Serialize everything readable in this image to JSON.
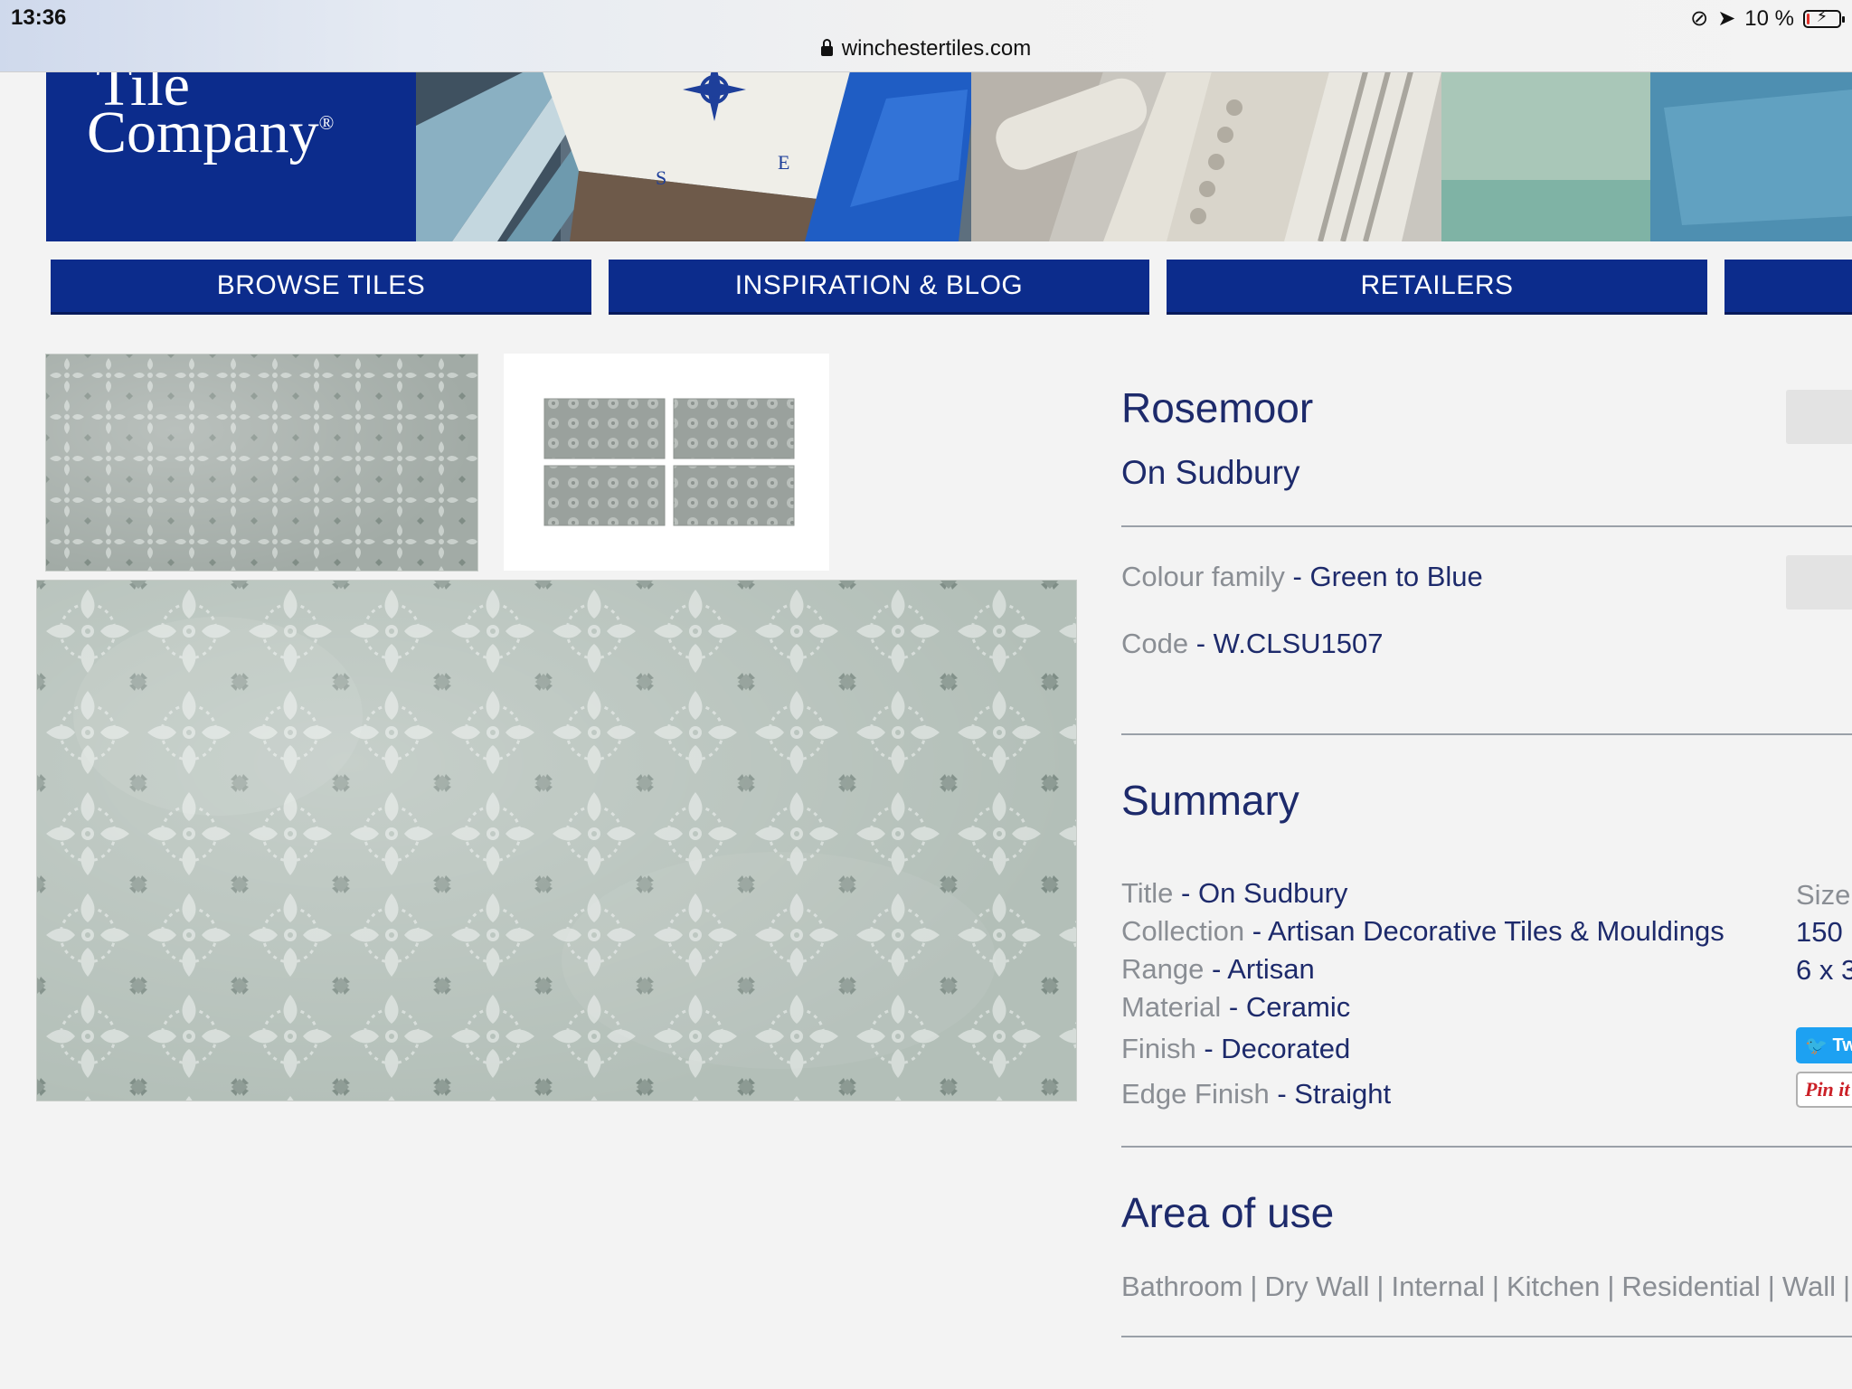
{
  "status": {
    "time": "13:36",
    "battery": "10 %",
    "battery_level": 0.1,
    "url": "winchestertiles.com"
  },
  "logo": {
    "line1": "Tile",
    "line2": "Company",
    "reg": "®"
  },
  "nav": [
    {
      "label": "BROWSE TILES"
    },
    {
      "label": "INSPIRATION & BLOG"
    },
    {
      "label": "RETAILERS"
    }
  ],
  "product": {
    "name": "Rosemoor",
    "subtitle": "On Sudbury",
    "colour_family": {
      "label": "Colour family",
      "value": "Green to Blue"
    },
    "code": {
      "label": "Code",
      "value": "W.CLSU1507"
    }
  },
  "summary": {
    "heading": "Summary",
    "rows": [
      {
        "label": "Title",
        "value": "On Sudbury"
      },
      {
        "label": "Collection",
        "value": "Artisan Decorative Tiles & Mouldings"
      },
      {
        "label": "Range",
        "value": "Artisan"
      },
      {
        "label": "Material",
        "value": "Ceramic"
      },
      {
        "label": "Finish",
        "value": "Decorated"
      },
      {
        "label": "Edge Finish",
        "value": "Straight"
      }
    ],
    "size_label": "Size",
    "size_line1": "150",
    "size_line2": "6 x 3"
  },
  "share": {
    "twitter": "Tw",
    "pinterest": "Pin it"
  },
  "area": {
    "heading": "Area of use",
    "items": [
      "Bathroom",
      "Dry Wall",
      "Internal",
      "Kitchen",
      "Residential",
      "Wall"
    ]
  },
  "colors": {
    "navy": "#0c2c8c",
    "text_navy": "#1d2a6b",
    "text_grey": "#8a8e94",
    "background": "#f3f3f3",
    "tile_green": "#b4c0b9"
  }
}
